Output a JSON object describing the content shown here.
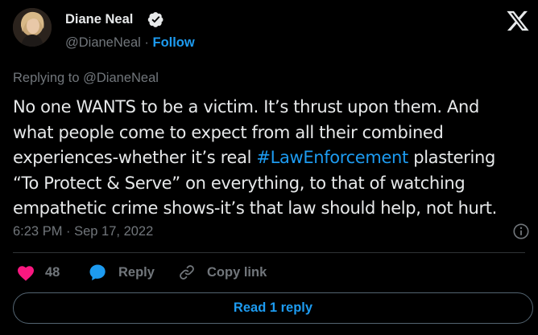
{
  "author": {
    "name": "Diane Neal",
    "handle": "@DianeNeal",
    "separator": "·",
    "follow_label": "Follow"
  },
  "tweet": {
    "replying_to": "Replying to @DianeNeal",
    "lines": [
      "No one WANTS to be a victim. It’s thrust upon them. And",
      "what people come to expect from all their combined",
      "experiences-whether it’s real ",
      "#LawEnforcement",
      " plastering",
      "“To Protect & Serve” on everything, to that of watching",
      "empathetic crime shows-it’s that law should help, not hurt."
    ],
    "timestamp": "6:23 PM · Sep 17, 2022"
  },
  "actions": {
    "like_count": "48",
    "reply_label": "Reply",
    "copy_link_label": "Copy link"
  },
  "read_replies_label": "Read 1 reply",
  "colors": {
    "background": "#000000",
    "text": "#e7e9ea",
    "muted": "#71767b",
    "accent": "#1d9bf0",
    "like": "#f91880",
    "divider": "#2f3336"
  }
}
